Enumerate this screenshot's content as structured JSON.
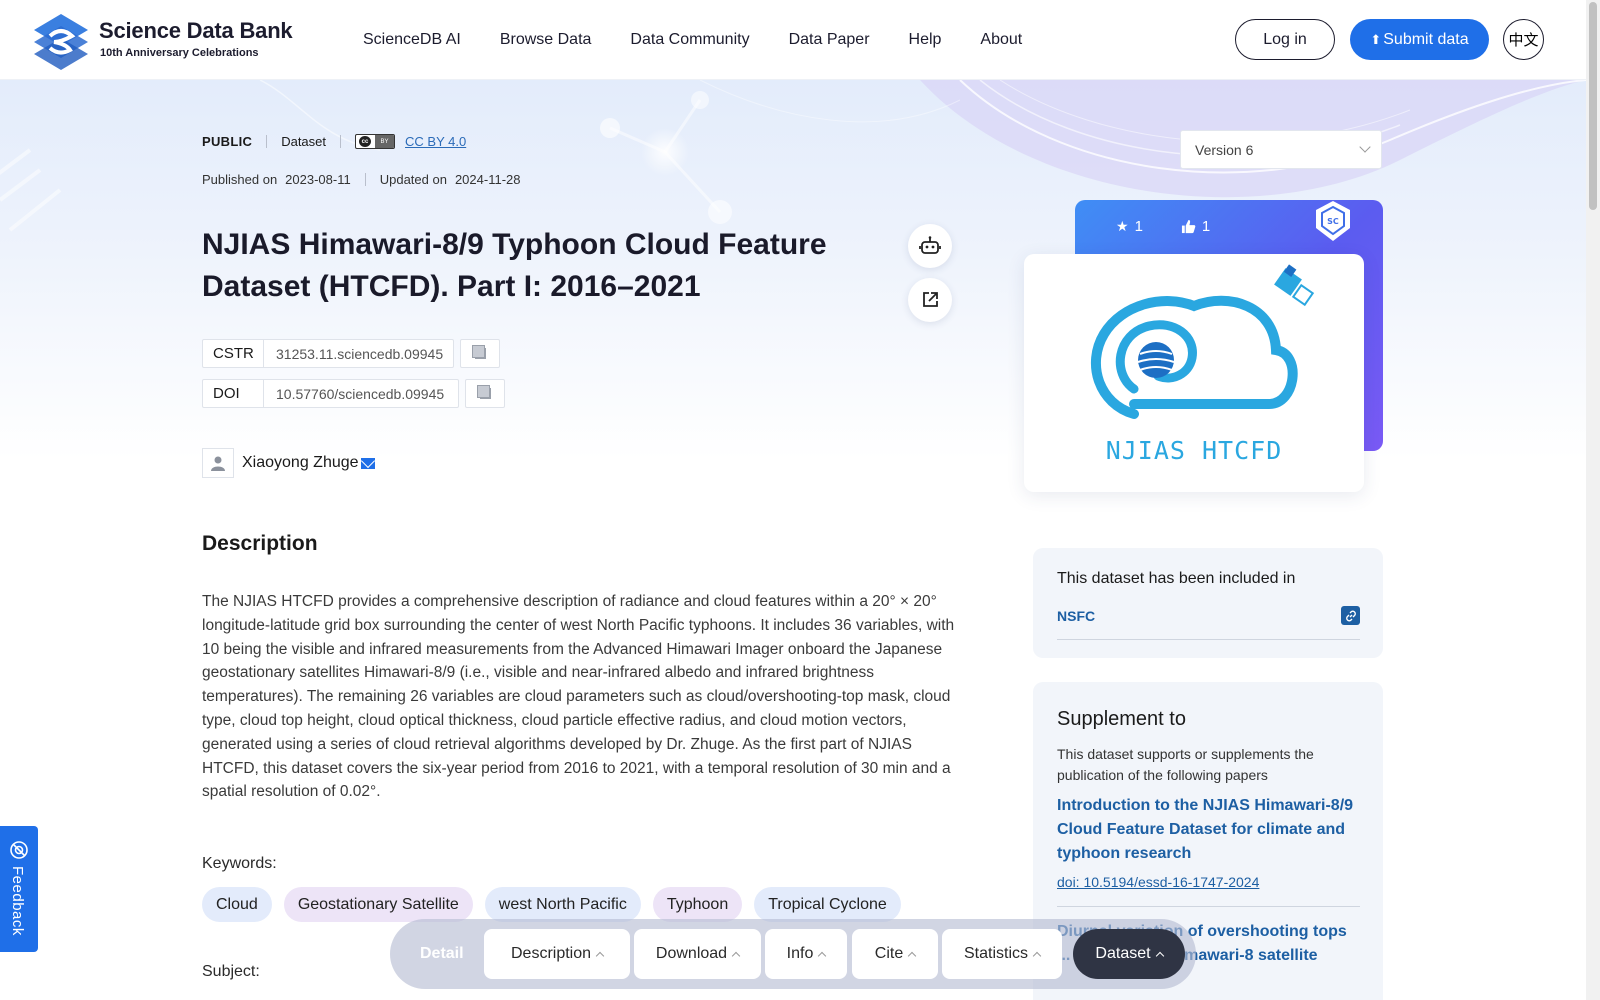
{
  "header": {
    "logo_title": "Science Data Bank",
    "logo_sub": "10th Anniversary Celebrations",
    "nav": [
      "ScienceDB AI",
      "Browse Data",
      "Data Community",
      "Data Paper",
      "Help",
      "About"
    ],
    "login_label": "Log in",
    "submit_label": "Submit data",
    "lang_label": "中文"
  },
  "meta": {
    "access": "PUBLIC",
    "type": "Dataset",
    "license": "CC BY 4.0",
    "published_label": "Published on",
    "published_date": "2023-08-11",
    "updated_label": "Updated on",
    "updated_date": "2024-11-28"
  },
  "version": {
    "selected": "Version 6"
  },
  "title": "NJIAS Himawari-8/9 Typhoon Cloud Feature Dataset (HTCFD). Part I: 2016–2021",
  "identifiers": {
    "cstr_label": "CSTR",
    "cstr_value": "31253.11.sciencedb.09945",
    "doi_label": "DOI",
    "doi_value": "10.57760/sciencedb.09945"
  },
  "author": {
    "name": "Xiaoyong Zhuge"
  },
  "description": {
    "heading": "Description",
    "text": "The NJIAS HTCFD provides a comprehensive description of radiance and cloud features within a 20° × 20° longitude-latitude grid box surrounding the center of west North Pacific typhoons. It includes 36 variables, with 10 being the visible and infrared measurements from the Advanced Himawari Imager onboard the Japanese geostationary satellites Himawari-8/9 (i.e., visible and near-infrared albedo and infrared brightness temperatures). The remaining 26 variables are cloud parameters such as cloud/overshooting-top mask, cloud type, cloud top height, cloud optical thickness, cloud particle effective radius, and cloud motion vectors, generated using a series of cloud retrieval algorithms developed by Dr. Zhuge. As the first part of NJIAS HTCFD, this dataset covers the six-year period from 2016 to 2021, with a temporal resolution of 30 min and a spatial resolution of 0.02°."
  },
  "keywords": {
    "label": "Keywords:",
    "items": [
      {
        "label": "Cloud",
        "color": "#e3ebfb"
      },
      {
        "label": "Geostationary Satellite",
        "color": "#ede4f7"
      },
      {
        "label": "west North Pacific",
        "color": "#e3ebfb"
      },
      {
        "label": "Typhoon",
        "color": "#ede4f7"
      },
      {
        "label": "Tropical Cyclone",
        "color": "#e3ebfb"
      }
    ]
  },
  "subject": {
    "label": "Subject:"
  },
  "card": {
    "stars": "1",
    "likes": "1",
    "logo_text": "NJIAS HTCFD"
  },
  "included": {
    "title": "This dataset has been included in",
    "item": "NSFC"
  },
  "supplement": {
    "title": "Supplement to",
    "desc": "This dataset supports or supplements the publication of the following papers",
    "paper1": "Introduction to the NJIAS Himawari-8/9 Cloud Feature Dataset for climate and typhoon research",
    "doi1": "doi: 10.5194/essd-16-1747-2024",
    "paper2": "Diurnal variation of overshooting tops ... detected by Himawari-8 satellite"
  },
  "feedback": {
    "label": "Feedback"
  },
  "bottom_nav": {
    "detail": "Detail",
    "items": [
      "Description",
      "Download",
      "Info",
      "Cite",
      "Statistics",
      "Dataset"
    ]
  },
  "colors": {
    "accent": "#1f6fe8",
    "link": "#1d5fa3",
    "card_gradient_start": "#3f8ef5",
    "card_gradient_end": "#7a5af5"
  }
}
